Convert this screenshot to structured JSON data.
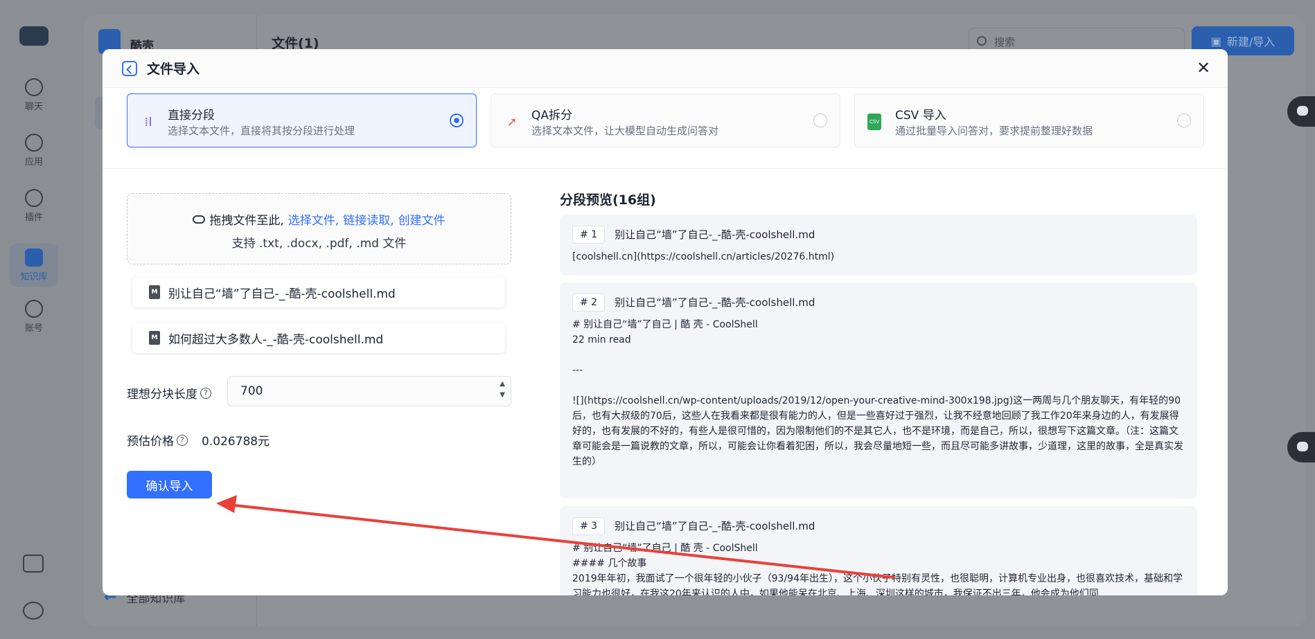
{
  "background_app": {
    "brand_name": "酷壳",
    "page_title": "文件(1)",
    "search_placeholder": "搜索",
    "new_import_label": "新建/导入",
    "back_label": "全部知识库",
    "nav": [
      {
        "label": "聊天",
        "icon": "chat-icon"
      },
      {
        "label": "应用",
        "icon": "robot-icon"
      },
      {
        "label": "插件",
        "icon": "puzzle-icon"
      },
      {
        "label": "知识库",
        "icon": "database-icon",
        "active": true
      },
      {
        "label": "账号",
        "icon": "user-icon"
      }
    ]
  },
  "modal": {
    "title": "文件导入",
    "import_types": [
      {
        "title": "直接分段",
        "desc": "选择文本文件，直接将其按分段进行处理",
        "selected": true,
        "icon": "text-split-icon"
      },
      {
        "title": "QA拆分",
        "desc": "选择文本文件，让大模型自动生成问答对",
        "selected": false,
        "icon": "rocket-icon"
      },
      {
        "title": "CSV 导入",
        "desc": "通过批量导入问答对，要求提前整理好数据",
        "selected": false,
        "icon": "csv-file-icon"
      }
    ],
    "upload": {
      "prefix": "拖拽文件至此,",
      "link_select": "选择文件,",
      "link_url": "链接读取,",
      "link_create": "创建文件",
      "support": "支持 .txt, .docx, .pdf, .md 文件"
    },
    "files": [
      "别让自己“墙”了自己-_-酷-壳-coolshell.md",
      "如何超过大多数人-_-酷-壳-coolshell.md"
    ],
    "chunk_length_label": "理想分块长度",
    "chunk_length_value": "700",
    "price_label": "预估价格",
    "price_value": "0.026788元",
    "confirm_label": "确认导入",
    "preview_title": "分段预览(16组)",
    "chunks": [
      {
        "idx": "# 1",
        "file": "别让自己“墙”了自己-_-酷-壳-coolshell.md",
        "text": "[coolshell.cn](https://coolshell.cn/articles/20276.html)"
      },
      {
        "idx": "# 2",
        "file": "别让自己“墙”了自己-_-酷-壳-coolshell.md",
        "text": "# 别让自己“墙”了自己 | 酷 壳 - CoolShell\n22 min read\n\n---\n\n![](https://coolshell.cn/wp-content/uploads/2019/12/open-your-creative-mind-300x198.jpg)这一两周与几个朋友聊天，有年轻的90后，也有大叔级的70后，这些人在我看来都是很有能力的人，但是一些喜好过于强烈，让我不经意地回顾了我工作20年来身边的人，有发展得好的，也有发展的不好的，有些人是很可惜的，因为限制他们的不是其它人，也不是环境，而是自己，所以，很想写下这篇文章。（注：这篇文章可能会是一篇说教的文章，所以，可能会让你看着犯困，所以，我会尽量地短一些，而且尽可能多讲故事，少道理，这里的故事，全是真实发生的）"
      },
      {
        "idx": "# 3",
        "file": "别让自己“墙”了自己-_-酷-壳-coolshell.md",
        "text": "# 别让自己“墙”了自己 | 酷 壳 - CoolShell\n#### 几个故事\n2019年年初，我面试了一个很年轻的小伙子（93/94年出生），这个小伙子特别有灵性，也很聪明，计算机专业出身，也很喜欢技术，基础和学习能力也很好，在我这20年来认识的人中，如果他能呆在北京、上海、深圳这样的城市，我保证不出三年，他会成为他们同"
      }
    ],
    "colors": {
      "accent": "#3370ff",
      "arrow": "#e8413a"
    }
  }
}
